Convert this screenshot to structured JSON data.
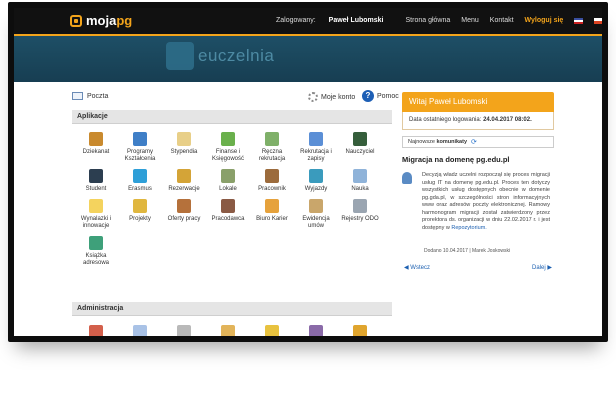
{
  "header": {
    "logo_main": "moja",
    "logo_accent": "pg",
    "logged_prefix": "Zalogowany:",
    "user_name": "Paweł Lubomski",
    "nav": [
      "Strona główna",
      "Menu",
      "Kontakt"
    ],
    "logout_label": "Wyloguj się",
    "accent_color": "#f3a41b"
  },
  "banner": {
    "text": "euczelnia"
  },
  "utility": {
    "mail_label": "Poczta",
    "account_label": "Moje konto",
    "help_label": "Pomoc"
  },
  "sections": {
    "apps_title": "Aplikacje",
    "admin_title": "Administracja"
  },
  "apps": [
    {
      "label": "Dziekanat",
      "color": "#c98a2e",
      "icon": "building-icon"
    },
    {
      "label": "Programy Kształcenia",
      "color": "#3f7fc7",
      "icon": "network-icon"
    },
    {
      "label": "Stypendia",
      "color": "#e8cf88",
      "icon": "document-icon"
    },
    {
      "label": "Finanse i Księgowość",
      "color": "#6ab04c",
      "icon": "money-icon"
    },
    {
      "label": "Ręczna rekrutacja",
      "color": "#7fb069",
      "icon": "form-icon"
    },
    {
      "label": "Rekrutacja i zapisy",
      "color": "#5b8fd6",
      "icon": "cube-icon"
    },
    {
      "label": "Nauczyciel",
      "color": "#355e3b",
      "icon": "blackboard-icon"
    },
    {
      "label": "Student",
      "color": "#2c3e50",
      "icon": "graduate-icon"
    },
    {
      "label": "Erasmus",
      "color": "#2e9fd8",
      "icon": "globe-icon"
    },
    {
      "label": "Rezerwacje",
      "color": "#d4a437",
      "icon": "calendar-icon"
    },
    {
      "label": "Lokale",
      "color": "#8aa06a",
      "icon": "room-icon"
    },
    {
      "label": "Pracownik",
      "color": "#9c6b3c",
      "icon": "worker-icon"
    },
    {
      "label": "Wyjazdy",
      "color": "#3a9bbd",
      "icon": "suitcase-icon"
    },
    {
      "label": "Nauka",
      "color": "#8fb3d9",
      "icon": "flask-icon"
    },
    {
      "label": "Wynalazki i innowacje",
      "color": "#f4d35e",
      "icon": "bulb-icon"
    },
    {
      "label": "Projekty",
      "color": "#e0b73f",
      "icon": "project-icon"
    },
    {
      "label": "Oferty pracy",
      "color": "#b5713b",
      "icon": "people-icon"
    },
    {
      "label": "Pracodawca",
      "color": "#8a5a44",
      "icon": "employer-icon"
    },
    {
      "label": "Biuro Karier",
      "color": "#e6a23c",
      "icon": "compass-icon"
    },
    {
      "label": "Ewidencja umów",
      "color": "#c9a66b",
      "icon": "archive-icon"
    },
    {
      "label": "Rejestry ODO",
      "color": "#9aa5b1",
      "icon": "registry-icon"
    },
    {
      "label": "Książka adresowa",
      "color": "#3ea07a",
      "icon": "addressbook-icon"
    }
  ],
  "admin_icons": [
    {
      "color": "#d35f4b",
      "icon": "admin-users-icon"
    },
    {
      "color": "#a9c2e6",
      "icon": "admin-mail-icon"
    },
    {
      "color": "#b9b9b9",
      "icon": "admin-doc-icon"
    },
    {
      "color": "#e2b45a",
      "icon": "admin-edit-icon"
    },
    {
      "color": "#e8c23f",
      "icon": "admin-coins-icon"
    },
    {
      "color": "#8a6aa8",
      "icon": "admin-group-icon"
    },
    {
      "color": "#e0a52e",
      "icon": "admin-lock-icon"
    }
  ],
  "sidebar": {
    "welcome": "Witaj Paweł Lubomski",
    "last_login_label": "Data ostatniego logowania:",
    "last_login_value": "24.04.2017 08:02.",
    "tab_prefix": "Najnowsze",
    "tab_label": "komunikaty",
    "news_title": "Migracja na domenę pg.edu.pl",
    "news_text": "Decyzją władz uczelni rozpoczął się proces migracji usług IT na domenę pg.edu.pl. Proces ten dotyczy wszystkich usług dostępnych obecnie w domenie pg.gda.pl, w szczególności stron informacyjnych www oraz adresów poczty elektronicznej. Ramowy harmonogram migracji został zatwierdzony przez prorektora ds. organizacji w dniu 22.02.2017 r. i jest dostępny w",
    "news_link": "Repozytorium.",
    "news_meta": "Dodano 10.04.2017 | Marek Joskowski",
    "prev_label": "Wstecz",
    "next_label": "Dalej"
  }
}
